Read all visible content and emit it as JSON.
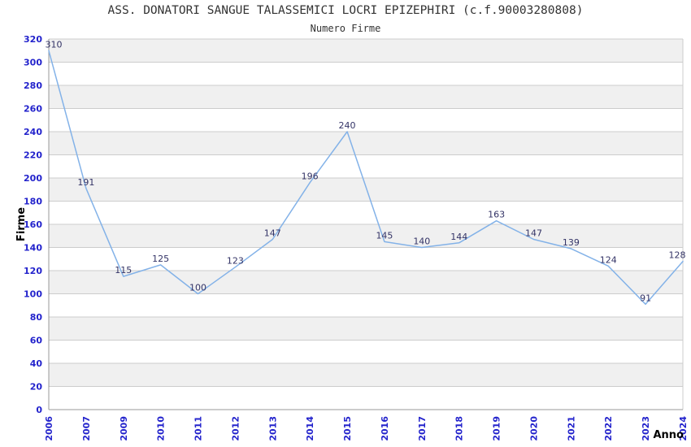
{
  "header": {
    "title": "ASS. DONATORI SANGUE TALASSEMICI LOCRI EPIZEPHIRI (c.f.90003280808)",
    "subtitle": "Numero Firme"
  },
  "chart_data": {
    "type": "line",
    "title": "ASS. DONATORI SANGUE TALASSEMICI LOCRI EPIZEPHIRI (c.f.90003280808)",
    "subtitle": "Numero Firme",
    "xlabel": "Anno",
    "ylabel": "Firme",
    "x": [
      "2006",
      "2007",
      "2009",
      "2010",
      "2011",
      "2012",
      "2013",
      "2014",
      "2015",
      "2016",
      "2017",
      "2018",
      "2019",
      "2020",
      "2021",
      "2022",
      "2023",
      "2024"
    ],
    "series": [
      {
        "name": "Numero Firme",
        "values": [
          310,
          191,
          115,
          125,
          100,
          123,
          147,
          196,
          240,
          145,
          140,
          144,
          163,
          147,
          139,
          124,
          91,
          128
        ]
      }
    ],
    "ylim": [
      0,
      320
    ],
    "ytick_step": 20,
    "grid": "horizontal-bands",
    "legend": "none",
    "colors": {
      "line": "#83b2e8",
      "data_label": "#333366",
      "tick_label": "#2323cc",
      "axis_title": "#000000",
      "title_text": "#333333",
      "band_fill": "#f0f0f0",
      "grid_line": "#cccccc",
      "axis_line": "#999999",
      "background": "#ffffff"
    }
  }
}
